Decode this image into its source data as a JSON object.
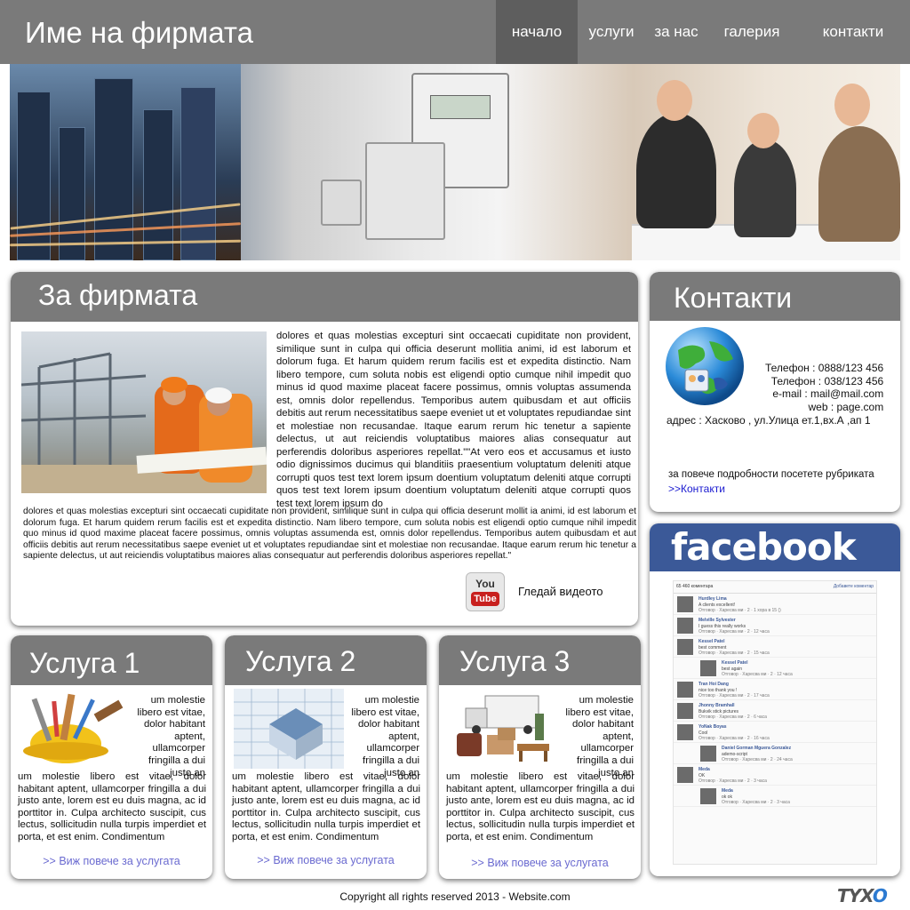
{
  "header": {
    "brand": "Име на фирмата",
    "nav": [
      "начало",
      "услуги",
      "за нас",
      "галерия",
      "контакти"
    ],
    "active_index": 0
  },
  "about": {
    "title": "За фирмата",
    "text_right": " dolores et quas molestias excepturi sint occaecati cupiditate non provident, similique sunt in culpa qui officia deserunt mollitia animi, id est laborum et dolorum fuga. Et harum quidem rerum facilis est et expedita distinctio. Nam libero tempore, cum soluta nobis est eligendi optio cumque nihil impedit quo minus id quod maxime placeat facere possimus, omnis voluptas assumenda est, omnis dolor repellendus. Temporibus autem quibusdam et aut officiis debitis aut rerum necessitatibus saepe eveniet ut et voluptates repudiandae sint et molestiae non recusandae. Itaque earum rerum hic tenetur a sapiente delectus, ut aut reiciendis voluptatibus maiores alias consequatur aut perferendis doloribus asperiores repellat.\"\"At vero eos et accusamus et iusto odio dignissimos ducimus qui blanditiis praesentium voluptatum deleniti atque corrupti quos test text lorem ipsum doentium voluptatum deleniti atque corrupti quos test text lorem ipsum doentium voluptatum deleniti atque corrupti quos test text lorem ipsum do",
    "text_full": "dolores et quas molestias excepturi sint occaecati cupiditate non provident, similique sunt in culpa qui officia deserunt mollit ia animi, id est laborum et dolorum fuga. Et harum quidem rerum facilis est et expedita distinctio. Nam libero tempore, cum soluta nobis est eligendi optio cumque nihil impedit quo minus id quod maxime placeat facere possimus, omnis voluptas assumenda est, omnis dolor repellendus. Temporibus autem quibusdam et aut officiis debitis aut rerum necessitatibus saepe eveniet ut et voluptates repudiandae sint et molestiae non recusandae. Itaque earum rerum hic tenetur a sapiente delectus, ut aut reiciendis voluptatibus maiores alias consequatur aut perferendis doloribus asperiores repellat.\"",
    "video_icon_you": "You",
    "video_icon_tube": "Tube",
    "video_link": "Гледай видеото"
  },
  "contacts": {
    "title": "Контакти",
    "phone1": "Телефон : 0888/123 456",
    "phone2": "Телефон : 038/123 456",
    "email": "e-mail  : mail@mail.com",
    "web": "web : page.com",
    "address": "адрес : Хасково , ул.Улица ет.1,вх.А ,ап 1",
    "more_text": "за повече подробности посетете рубриката",
    "more_link": ">>Контакти"
  },
  "facebook": {
    "logo": "facebook",
    "top_left": "65 460 коментара",
    "top_right": "Добавете коментар",
    "posts": [
      {
        "name": "Hurdley Lima",
        "text": "A clients excellent!",
        "meta": "Отговор · Харесва ми · 2 · 1 хора в 15 ()",
        "sub": false
      },
      {
        "name": "Melville Sylvester",
        "text": "I guess this really works",
        "meta": "Отговор · Харесва ми · 2 · 12 часа",
        "sub": false
      },
      {
        "name": "Kessel Patel",
        "text": "best comment",
        "meta": "Отговор · Харесва ми · 2 · 15 часа",
        "sub": false
      },
      {
        "name": "Kessel Patel",
        "text": "best again",
        "meta": "Отговор · Харесва ми · 2 · 12 часа",
        "sub": true
      },
      {
        "name": "Tran Hoi Dang",
        "text": "nice too thank you !",
        "meta": "Отговор · Харесва ми · 2 · 17 часа",
        "sub": false
      },
      {
        "name": "Jhonny Bramhall",
        "text": "Bukvik stick pictures",
        "meta": "Отговор · Харесва ми · 2 · 6 часа",
        "sub": false
      },
      {
        "name": "YoNak Boyas",
        "text": "Cool",
        "meta": "Отговор · Харесва ми · 2 · 16 часа",
        "sub": false
      },
      {
        "name": "Daniel Gorman Mguera Gonzalez",
        "text": "ademo-script",
        "meta": "Отговор · Харесва ми · 2 · 24 часа",
        "sub": true
      },
      {
        "name": "Meda",
        "text": "OK",
        "meta": "Отговор · Харесва ми · 2 · 3 часа",
        "sub": false
      },
      {
        "name": "Meda",
        "text": "ok ok",
        "meta": "Отговор · Харесва ми · 2 · 3 часа",
        "sub": true
      }
    ]
  },
  "services": [
    {
      "title": "Услуга 1",
      "text_right": "um molestie libero est vitae, dolor habitant aptent, ullamcorper fringilla a dui justo an",
      "text_full": "um molestie libero est vitae, dolor habitant aptent, ullamcorper fringilla a dui justo ante, lorem est eu duis magna, ac id porttitor in. Culpa architecto suscipit, cus lectus, sollicitudin nulla turpis imperdiet et porta, et est enim. Condimentum",
      "link": ">> Виж повече за услугата"
    },
    {
      "title": "Услуга 2",
      "text_right": "um molestie libero est vitae, dolor habitant aptent, ullamcorper fringilla a dui justo an",
      "text_full": "um molestie libero est vitae, dolor habitant aptent, ullamcorper fringilla a dui justo ante, lorem est eu duis magna, ac id porttitor in. Culpa architecto suscipit, cus lectus, sollicitudin nulla turpis imperdiet et porta, et est enim. Condimentum",
      "link": ">> Виж повече за услугата"
    },
    {
      "title": "Услуга 3",
      "text_right": "um molestie libero est vitae, dolor habitant aptent, ullamcorper fringilla a dui justo an",
      "text_full": "um molestie libero est vitae, dolor habitant aptent, ullamcorper fringilla a dui justo ante, lorem est eu duis magna, ac id porttitor in. Culpa architecto suscipit, cus lectus, sollicitudin nulla turpis imperdiet et porta, et est enim. Condimentum",
      "link": ">> Виж повече за услугата"
    }
  ],
  "footer": {
    "copyright": "Copyright all rights reserved 2013 - Website.com",
    "counter_logo": "TYXO"
  },
  "colors": {
    "header_bg": "#7a7a7a",
    "nav_active_bg": "#5e5e5e",
    "facebook_blue": "#3b5998",
    "link_blue": "#1a1ad0",
    "service_link": "#6a6ad0"
  },
  "icons": [
    "globe-contact-icon",
    "youtube-icon",
    "tools-helmet-icon",
    "house-blueprint-icon",
    "moving-truck-icon"
  ]
}
